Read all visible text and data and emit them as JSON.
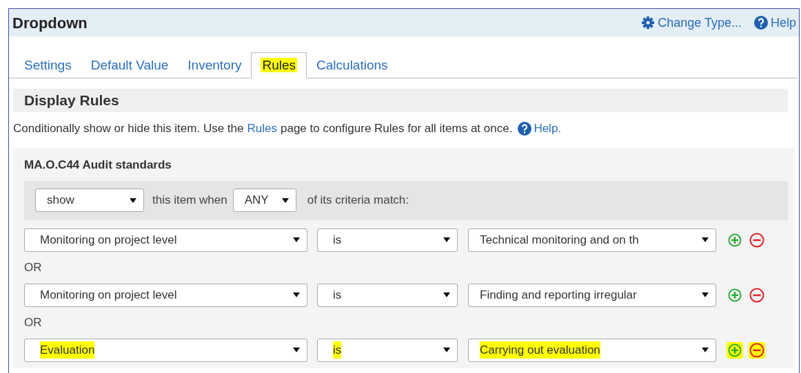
{
  "window": {
    "title": "Dropdown"
  },
  "header_links": [
    {
      "kind": "gear",
      "label": "Change Type..."
    },
    {
      "kind": "help",
      "label": "Help"
    }
  ],
  "tabs": [
    {
      "label": "Settings",
      "selected": false,
      "highlighted": false
    },
    {
      "label": "Default Value",
      "selected": false,
      "highlighted": false
    },
    {
      "label": "Inventory",
      "selected": false,
      "highlighted": false
    },
    {
      "label": "Rules",
      "selected": true,
      "highlighted": true
    },
    {
      "label": "Calculations",
      "selected": false,
      "highlighted": false
    }
  ],
  "section": {
    "title": "Display Rules",
    "description_before": "Conditionally show or hide this item. Use the",
    "description_link": "Rules",
    "description_after": "page to configure Rules for all items at once.",
    "help_link": "Help."
  },
  "rule": {
    "title": "MA.O.C44 Audit standards",
    "action": "show",
    "text_middle": "this item when",
    "match": "ANY",
    "text_end": "of its criteria match:",
    "criteria": [
      {
        "field": "Monitoring on project level",
        "operator": "is",
        "value": "Technical monitoring and on th",
        "highlighted": false,
        "connector": "OR"
      },
      {
        "field": "Monitoring on project level",
        "operator": "is",
        "value": "Finding and reporting irregular",
        "highlighted": false,
        "connector": "OR"
      },
      {
        "field": "Evaluation",
        "operator": "is",
        "value": "Carrying out evaluation",
        "highlighted": true
      }
    ]
  }
}
